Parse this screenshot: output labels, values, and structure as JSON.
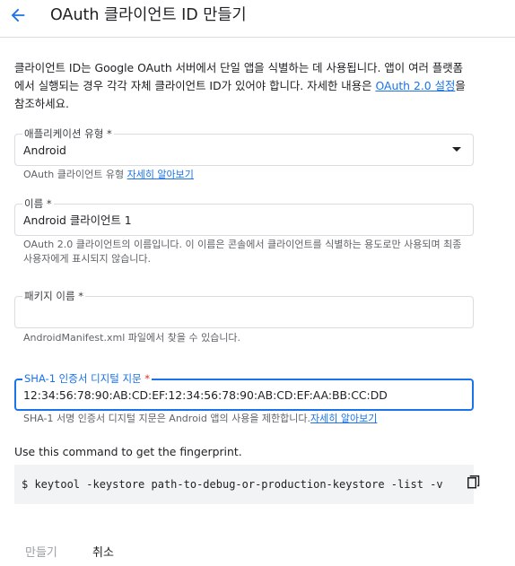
{
  "header": {
    "title": "OAuth 클라이언트 ID 만들기"
  },
  "intro": {
    "text": "클라이언트 ID는 Google OAuth 서버에서 단일 앱을 식별하는 데 사용됩니다. 앱이 여러 플랫폼에서 실행되는 경우 각각 자체 클라이언트 ID가 있어야 합니다. 자세한 내용은 ",
    "link": "OAuth 2.0 설정",
    "suffix": "을 참조하세요."
  },
  "app_type": {
    "label": "애플리케이션 유형 *",
    "value": "Android",
    "hint": "OAuth 클라이언트 유형 ",
    "hint_link": "자세히 알아보기"
  },
  "name": {
    "label": "이름 *",
    "value": "Android 클라이언트 1",
    "hint": "OAuth 2.0 클라이언트의 이름입니다. 이 이름은 콘솔에서 클라이언트를 식별하는 용도로만 사용되며 최종 사용자에게 표시되지 않습니다."
  },
  "package": {
    "label": "패키지 이름 *",
    "value": "",
    "hint": "AndroidManifest.xml 파일에서 찾을 수 있습니다."
  },
  "sha1": {
    "label": "SHA-1 인증서 디지털 지문",
    "required_mark": "*",
    "value": "12:34:56:78:90:AB:CD:EF:12:34:56:78:90:AB:CD:EF:AA:BB:CC:DD",
    "hint": "SHA-1 서명 인증서 디지털 지문은 Android 앱의 사용을 제한합니다.",
    "hint_link": "자세히 알아보기"
  },
  "command": {
    "label": "Use this command to get the fingerprint.",
    "code": "$ keytool -keystore path-to-debug-or-production-keystore -list -v"
  },
  "actions": {
    "create": "만들기",
    "cancel": "취소"
  },
  "colors": {
    "accent": "#1a73e8",
    "required": "#d93025",
    "disabled": "#9aa0a6"
  }
}
